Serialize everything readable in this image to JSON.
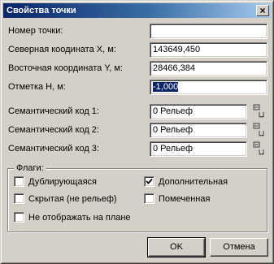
{
  "window": {
    "title": "Свойства точки",
    "close_glyph": "×"
  },
  "fields": [
    {
      "label": "Номер точки:",
      "value": ""
    },
    {
      "label": "Северная коодината X, м:",
      "value": "143649,450"
    },
    {
      "label": "Восточная координата Y, м:",
      "value": "28466,384"
    },
    {
      "label": "Отметка H, м:",
      "value": "-1,000",
      "selected": true
    }
  ],
  "semantic_codes": [
    {
      "label": "Семантический код 1:",
      "value": "0 Рельеф",
      "picker_icon": "picker-icon"
    },
    {
      "label": "Семантический код 2:",
      "value": "0 Рельеф",
      "picker_icon": "picker-icon"
    },
    {
      "label": "Семантический код 3:",
      "value": "0 Рельеф",
      "picker_icon": "picker-icon"
    }
  ],
  "flags": {
    "title": "Флаги:",
    "items": [
      {
        "label": "Дублирующаяся",
        "checked": false
      },
      {
        "label": "Дополнительная",
        "checked": true
      },
      {
        "label": "Скрытая (не рельеф)",
        "checked": false
      },
      {
        "label": "Помеченная",
        "checked": false
      },
      {
        "label": "Не отображать на плане",
        "checked": false
      }
    ]
  },
  "buttons": {
    "ok": "OK",
    "cancel": "Отмена"
  }
}
